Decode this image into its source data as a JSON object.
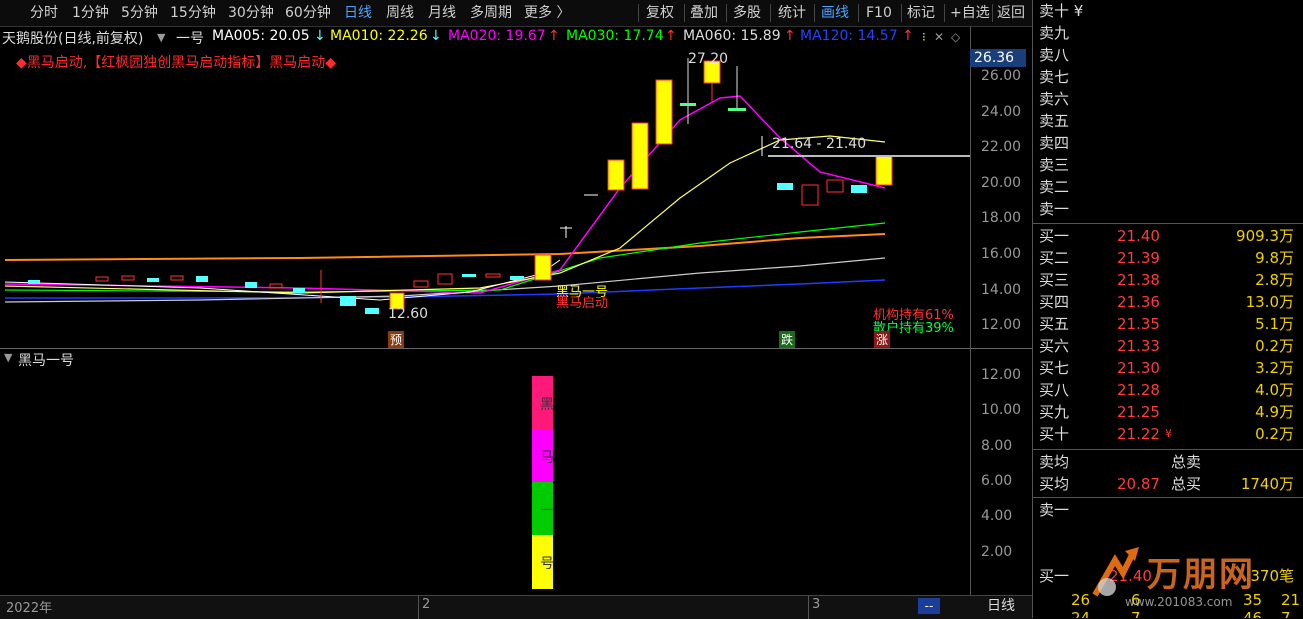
{
  "toolbar": {
    "left_items": [
      "分时",
      "1分钟",
      "5分钟",
      "15分钟",
      "30分钟",
      "60分钟",
      "日线",
      "周线",
      "月线",
      "多周期",
      "更多 〉"
    ],
    "active": "日线",
    "right_items": [
      "复权",
      "叠加",
      "多股",
      "统计",
      "画线",
      "F10",
      "标记",
      "+自选",
      "返回"
    ],
    "right_active": "画线"
  },
  "info": {
    "stock": "天鹅股份(日线,前复权)",
    "indicator": "一号",
    "ma005": "MA005: 20.05",
    "ma005_arrow": "↓",
    "ma010": "MA010: 22.26",
    "ma010_arrow": "↓",
    "ma020": "MA020: 19.67",
    "ma020_arrow": "↑",
    "ma030": "MA030: 17.74",
    "ma030_arrow": "↑",
    "ma060": "MA060: 15.89",
    "ma060_arrow": "↑",
    "ma120": "MA120: 14.57",
    "ma120_arrow": "↑"
  },
  "signal_text": "◆黑马启动,【红枫园独创黑马启动指标】黑马启动◆",
  "price_tag": "26.36",
  "main_axis": [
    "26.00",
    "24.00",
    "22.00",
    "20.00",
    "18.00",
    "16.00",
    "14.00",
    "12.00"
  ],
  "sub_axis": [
    "12.00",
    "10.00",
    "8.00",
    "6.00",
    "4.00",
    "2.00"
  ],
  "annotations": {
    "high": "27.20",
    "low": "12.60",
    "range": "21.64 - 21.40",
    "inst": "机构持有61%",
    "retail": "散户持有39%",
    "mark_pre": "预",
    "mark_fall": "跌",
    "mark_rise": "涨",
    "horse_label": "黑马一号",
    "horse_label2": "黑马启动"
  },
  "sub_panel": {
    "title": "黑马一号",
    "chars": [
      "黑",
      "马",
      "一",
      "号"
    ]
  },
  "bottom": {
    "year": "2022年",
    "m2": "2",
    "m3": "3",
    "dash": "--",
    "tab": "日线"
  },
  "orderbook": {
    "sell_top_label": "卖十 ¥",
    "sell": [
      "卖九",
      "卖八",
      "卖七",
      "卖六",
      "卖五",
      "卖四",
      "卖三",
      "卖二",
      "卖一"
    ],
    "buy": [
      {
        "label": "买一",
        "price": "21.40",
        "vol": "909.3万"
      },
      {
        "label": "买二",
        "price": "21.39",
        "vol": "9.8万"
      },
      {
        "label": "买三",
        "price": "21.38",
        "vol": "2.8万"
      },
      {
        "label": "买四",
        "price": "21.36",
        "vol": "13.0万"
      },
      {
        "label": "买五",
        "price": "21.35",
        "vol": "5.1万"
      },
      {
        "label": "买六",
        "price": "21.33",
        "vol": "0.2万"
      },
      {
        "label": "买七",
        "price": "21.30",
        "vol": "3.2万"
      },
      {
        "label": "买八",
        "price": "21.28",
        "vol": "4.0万"
      },
      {
        "label": "买九",
        "price": "21.25",
        "vol": "4.9万"
      },
      {
        "label": "买十",
        "price": "21.22",
        "vol": "0.2万",
        "mark": "¥"
      }
    ],
    "avg_sell_label": "卖均",
    "total_sell_label": "总卖",
    "avg_buy_label": "买均",
    "avg_buy": "20.87",
    "total_buy_label": "总买",
    "total_buy": "1740万",
    "sell1_label": "卖一",
    "buy1_label": "买一",
    "buy1_price": "21.40",
    "buy1_count": "370笔",
    "tick_row": [
      "26",
      "6",
      "35",
      "21"
    ],
    "tick_row2": [
      "24",
      "7",
      "46",
      "7"
    ]
  },
  "watermark": {
    "brand": "万朋网",
    "url": "www.201083.com"
  },
  "colors": {
    "ma5": "#ffffff",
    "ma10": "#ffff00",
    "ma20": "#ff00ff",
    "ma30": "#00ff00",
    "ma60": "#cccccc",
    "ma120": "#1e3cff",
    "up": "#ff3232",
    "down": "#54ffff",
    "yellow": "#ffff00"
  }
}
